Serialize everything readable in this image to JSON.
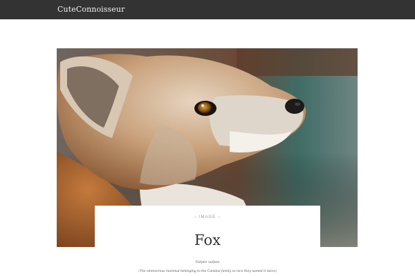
{
  "header": {
    "site_title": "CuteConnoisseur"
  },
  "post": {
    "format_label": "– IMAGE –",
    "title": "Fox",
    "subtitle": "Vulpes vulpes",
    "description": "(The omnivorous mammal belonging to the Canidae family so nice they named it twice)"
  },
  "colors": {
    "header_bg": "#333333",
    "page_bg": "#ffffff"
  }
}
